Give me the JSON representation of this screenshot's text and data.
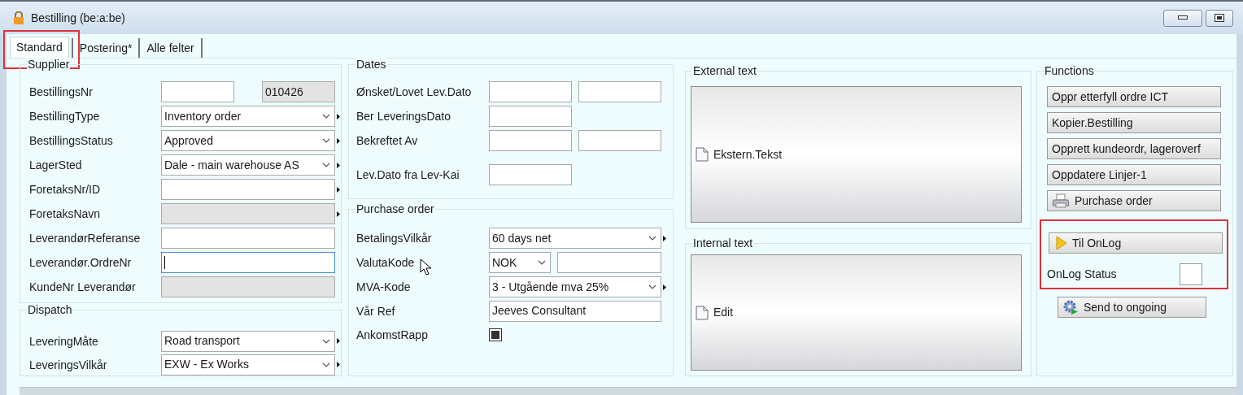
{
  "window": {
    "title": "Bestilling (be:a:be)"
  },
  "tabs": [
    {
      "label": "Standard",
      "selected": true,
      "highlighted": true
    },
    {
      "label": "Postering*",
      "selected": false,
      "highlighted": false
    },
    {
      "label": "Alle felter",
      "selected": false,
      "highlighted": false
    }
  ],
  "supplier": {
    "title": "Supplier",
    "rows": [
      {
        "label": "BestillingsNr",
        "kind": "pair",
        "link": false,
        "inputs": [
          {
            "kind": "text",
            "readonly": false,
            "focused": false
          },
          {
            "kind": "text",
            "value": "010426",
            "readonly": true,
            "focused": false
          }
        ]
      },
      {
        "label": "BestillingType",
        "kind": "full",
        "link": true,
        "inputs": [
          {
            "kind": "combo",
            "value": "Inventory order",
            "readonly": false,
            "focused": false
          }
        ]
      },
      {
        "label": "BestillingsStatus",
        "kind": "full",
        "link": true,
        "inputs": [
          {
            "kind": "combo",
            "value": "Approved",
            "readonly": false,
            "focused": false
          }
        ]
      },
      {
        "label": "LagerSted",
        "kind": "full",
        "link": true,
        "inputs": [
          {
            "kind": "combo",
            "value": "Dale - main warehouse AS",
            "readonly": false,
            "focused": false
          }
        ]
      },
      {
        "label": "ForetaksNr/ID",
        "kind": "full",
        "link": true,
        "inputs": [
          {
            "kind": "text",
            "readonly": false,
            "focused": false
          }
        ]
      },
      {
        "label": "ForetaksNavn",
        "kind": "full",
        "link": true,
        "inputs": [
          {
            "kind": "text",
            "readonly": true,
            "focused": false
          }
        ]
      },
      {
        "label": "LeverandørReferanse",
        "kind": "full",
        "link": false,
        "inputs": [
          {
            "kind": "text",
            "readonly": false,
            "focused": false
          }
        ]
      },
      {
        "label": "Leverandør.OrdreNr",
        "kind": "full",
        "link": false,
        "inputs": [
          {
            "kind": "text",
            "readonly": false,
            "focused": true
          }
        ]
      },
      {
        "label": "KundeNr Leverandør",
        "kind": "full",
        "link": false,
        "inputs": [
          {
            "kind": "text",
            "readonly": true,
            "focused": false
          }
        ]
      }
    ]
  },
  "dispatch": {
    "title": "Dispatch",
    "rows": [
      {
        "label": "LeveringMåte",
        "kind": "full",
        "link": true,
        "inputs": [
          {
            "kind": "combo",
            "value": "Road transport",
            "readonly": false,
            "focused": false
          }
        ]
      },
      {
        "label": "LeveringsVilkår",
        "kind": "full",
        "link": true,
        "inputs": [
          {
            "kind": "combo",
            "value": "EXW - Ex Works",
            "readonly": false,
            "focused": false
          }
        ]
      }
    ]
  },
  "dates": {
    "title": "Dates",
    "rows": [
      {
        "label": "Ønsket/Lovet Lev.Dato",
        "kind": "pair",
        "link": false,
        "inputs": [
          {
            "kind": "text",
            "readonly": false,
            "focused": false
          },
          {
            "kind": "text",
            "readonly": false,
            "focused": false
          }
        ]
      },
      {
        "label": "Ber LeveringsDato",
        "kind": "short",
        "link": false,
        "inputs": [
          {
            "kind": "text",
            "readonly": false,
            "focused": false
          }
        ]
      },
      {
        "label": "Bekreftet Av",
        "kind": "pair",
        "link": false,
        "inputs": [
          {
            "kind": "text",
            "readonly": false,
            "focused": false
          },
          {
            "kind": "text",
            "readonly": false,
            "focused": false
          }
        ]
      },
      {
        "label": "Lev.Dato fra Lev-Kai",
        "kind": "short",
        "link": false,
        "inputs": [
          {
            "kind": "text",
            "readonly": false,
            "focused": false
          }
        ]
      }
    ]
  },
  "purchase_order": {
    "title": "Purchase order",
    "rows": [
      {
        "label": "BetalingsVilkår",
        "kind": "full",
        "link": true,
        "inputs": [
          {
            "kind": "combo",
            "value": "60 days net",
            "readonly": false,
            "focused": false
          }
        ]
      },
      {
        "label": "ValutaKode",
        "kind": "split",
        "link": false,
        "inputs": [
          {
            "kind": "combo",
            "value": "NOK",
            "readonly": false,
            "focused": false
          },
          {
            "kind": "text",
            "readonly": false,
            "focused": false
          }
        ]
      },
      {
        "label": "MVA-Kode",
        "kind": "full",
        "link": true,
        "inputs": [
          {
            "kind": "combo",
            "value": "3 - Utgående mva 25%",
            "readonly": false,
            "focused": false
          }
        ]
      },
      {
        "label": "Vår Ref",
        "kind": "full",
        "link": false,
        "inputs": [
          {
            "kind": "text",
            "value": "Jeeves Consultant",
            "readonly": false,
            "focused": false
          }
        ]
      },
      {
        "label": "AnkomstRapp",
        "kind": "check",
        "link": false,
        "inputs": [
          {
            "kind": "checkbox",
            "checked": true
          }
        ]
      }
    ]
  },
  "external_text": {
    "title": "External text",
    "button": "Ekstern.Tekst"
  },
  "internal_text": {
    "title": "Internal text",
    "button": "Edit"
  },
  "functions": {
    "title": "Functions",
    "buttons": [
      {
        "label": "Oppr etterfyll ordre ICT",
        "kind": "plain"
      },
      {
        "label": "Kopier.Bestilling",
        "kind": "plain"
      },
      {
        "label": "Opprett kundeordr, lageroverf",
        "kind": "plain"
      },
      {
        "label": "Oppdatere Linjer-1",
        "kind": "plain"
      },
      {
        "label": "Purchase order",
        "kind": "print"
      }
    ],
    "onlog": {
      "highlighted": true,
      "button": {
        "label": "Til OnLog",
        "kind": "play"
      },
      "status_label": "OnLog Status"
    },
    "send_button": {
      "label": "Send to ongoing",
      "kind": "process"
    }
  }
}
